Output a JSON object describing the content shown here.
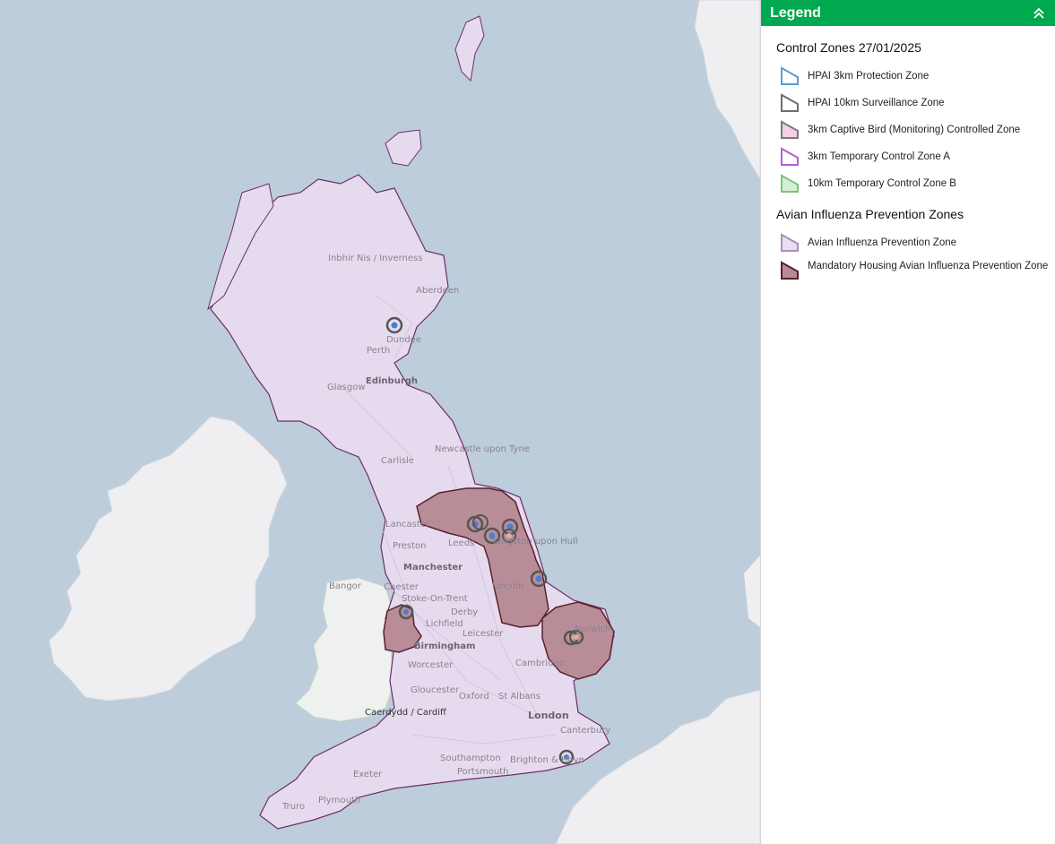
{
  "legend": {
    "title": "Legend",
    "sections": [
      {
        "title": "Control Zones 27/01/2025",
        "items": [
          {
            "label": "HPAI 3km Protection Zone",
            "stroke": "#5b9bd5",
            "fill": "#ffffff"
          },
          {
            "label": "HPAI 10km Surveillance Zone",
            "stroke": "#6e6e6e",
            "fill": "#ffffff"
          },
          {
            "label": "3km Captive Bird (Monitoring) Controlled Zone",
            "stroke": "#7a7a7a",
            "fill": "#f4cfe6"
          },
          {
            "label": "3km Temporary Control Zone A",
            "stroke": "#b061d1",
            "fill": "#ffffff"
          },
          {
            "label": "10km Temporary Control Zone B",
            "stroke": "#7bc47f",
            "fill": "#d5f0d6"
          }
        ]
      },
      {
        "title": "Avian Influenza Prevention Zones",
        "items": [
          {
            "label": "Avian Influenza Prevention Zone",
            "stroke": "#a98fb8",
            "fill": "#eadff2"
          },
          {
            "label": "Mandatory Housing Avian Influenza Prevention Zone",
            "stroke": "#5a1f2e",
            "fill": "#b98a95"
          }
        ]
      }
    ]
  },
  "map": {
    "colors": {
      "sea": "#bdcddb",
      "land": "#eeeef1",
      "aipz": "#e6dbee",
      "aipz_border": "#6b2d6b",
      "housing": "#b98d98",
      "housing_border": "#5a1f2e"
    },
    "places": [
      "Inbhir Nis / Inverness",
      "Aberdeen",
      "Dundee",
      "Perth",
      "Glasgow",
      "Edinburgh",
      "Newcastle upon Tyne",
      "Carlisle",
      "Lancaster",
      "Preston",
      "Leeds",
      "Kingston upon Hull",
      "Manchester",
      "Bangor",
      "Chester",
      "Stoke-On-Trent",
      "Derby",
      "Lichfield",
      "Lincoln",
      "Leicester",
      "Birmingham",
      "Norwich",
      "Worcester",
      "Cambridge",
      "Gloucester",
      "Oxford",
      "St Albans",
      "London",
      "Caerdydd / Cardiff",
      "Canterbury",
      "Southampton",
      "Brighton & Hove",
      "Portsmouth",
      "Exeter",
      "Plymouth",
      "Truro"
    ]
  }
}
